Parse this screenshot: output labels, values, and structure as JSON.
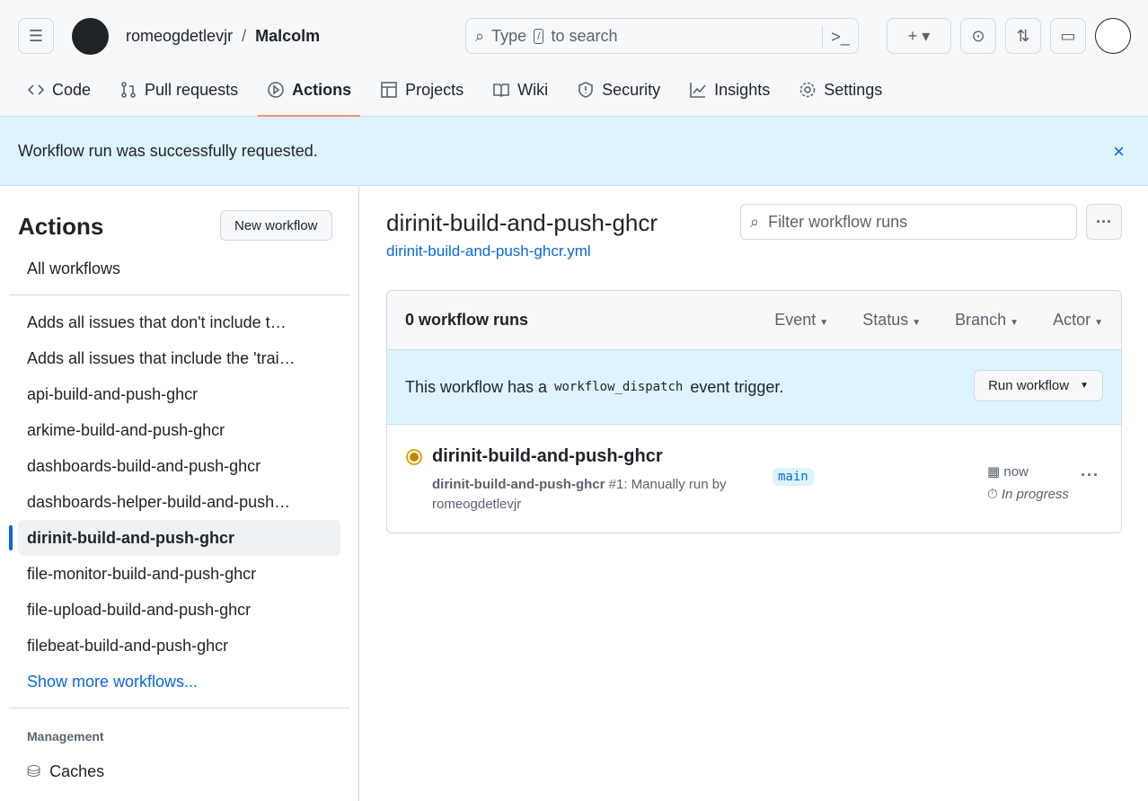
{
  "header": {
    "owner": "romeogdetlevjr",
    "separator": "/",
    "repo": "Malcolm",
    "search_prefix": "Type",
    "search_key": "/",
    "search_suffix": "to search"
  },
  "nav": [
    "Code",
    "Pull requests",
    "Actions",
    "Projects",
    "Wiki",
    "Security",
    "Insights",
    "Settings"
  ],
  "flash": {
    "message": "Workflow run was successfully requested.",
    "close": "×"
  },
  "sidebar": {
    "title": "Actions",
    "new_workflow": "New workflow",
    "all_workflows": "All workflows",
    "workflows": [
      "Adds all issues that don't include t…",
      "Adds all issues that include the 'trai…",
      "api-build-and-push-ghcr",
      "arkime-build-and-push-ghcr",
      "dashboards-build-and-push-ghcr",
      "dashboards-helper-build-and-push…",
      "dirinit-build-and-push-ghcr",
      "file-monitor-build-and-push-ghcr",
      "file-upload-build-and-push-ghcr",
      "filebeat-build-and-push-ghcr"
    ],
    "active_index": 6,
    "show_more": "Show more workflows...",
    "management": "Management",
    "caches": "Caches"
  },
  "main": {
    "title": "dirinit-build-and-push-ghcr",
    "file": "dirinit-build-and-push-ghcr.yml",
    "filter_placeholder": "Filter workflow runs",
    "runs_count": "0 workflow runs",
    "filters": [
      "Event",
      "Status",
      "Branch",
      "Actor"
    ],
    "dispatch_pre": "This workflow has a",
    "dispatch_code": "workflow_dispatch",
    "dispatch_post": "event trigger.",
    "run_workflow": "Run workflow",
    "run": {
      "title": "dirinit-build-and-push-ghcr",
      "workflow": "dirinit-build-and-push-ghcr",
      "meta": "#1: Manually run by romeogdetlevjr",
      "branch": "main",
      "time": "now",
      "state": "In progress",
      "status_color": "#bf8700"
    }
  },
  "colors": {
    "accent": "#0969da",
    "tab_underline": "#fd8c73",
    "flash_bg": "#ddf4ff"
  }
}
